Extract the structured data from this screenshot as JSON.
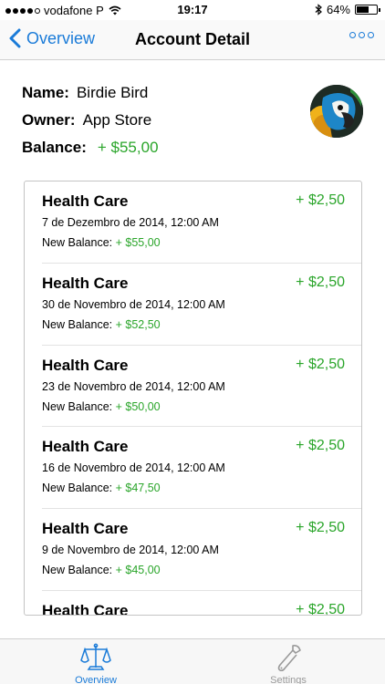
{
  "status_bar": {
    "carrier": "vodafone P",
    "time": "19:17",
    "battery": "64%",
    "battery_level": 0.64
  },
  "nav": {
    "back_label": "Overview",
    "title": "Account Detail"
  },
  "account": {
    "name_label": "Name:",
    "name": "Birdie Bird",
    "owner_label": "Owner:",
    "owner": "App Store",
    "balance_label": "Balance:",
    "balance": "+ $55,00"
  },
  "transactions": [
    {
      "title": "Health Care",
      "amount": "+ $2,50",
      "date": "7 de Dezembro de 2014, 12:00 AM",
      "balance_label": "New Balance:",
      "balance": "+ $55,00"
    },
    {
      "title": "Health Care",
      "amount": "+ $2,50",
      "date": "30 de Novembro de 2014, 12:00 AM",
      "balance_label": "New Balance:",
      "balance": "+ $52,50"
    },
    {
      "title": "Health Care",
      "amount": "+ $2,50",
      "date": "23 de Novembro de 2014, 12:00 AM",
      "balance_label": "New Balance:",
      "balance": "+ $50,00"
    },
    {
      "title": "Health Care",
      "amount": "+ $2,50",
      "date": "16 de Novembro de 2014, 12:00 AM",
      "balance_label": "New Balance:",
      "balance": "+ $47,50"
    },
    {
      "title": "Health Care",
      "amount": "+ $2,50",
      "date": "9 de Novembro de 2014, 12:00 AM",
      "balance_label": "New Balance:",
      "balance": "+ $45,00"
    },
    {
      "title": "Health Care",
      "amount": "+ $2,50"
    }
  ],
  "tabs": {
    "overview": "Overview",
    "settings": "Settings"
  },
  "colors": {
    "accent": "#1a7bd8",
    "positive": "#2aa52a"
  }
}
